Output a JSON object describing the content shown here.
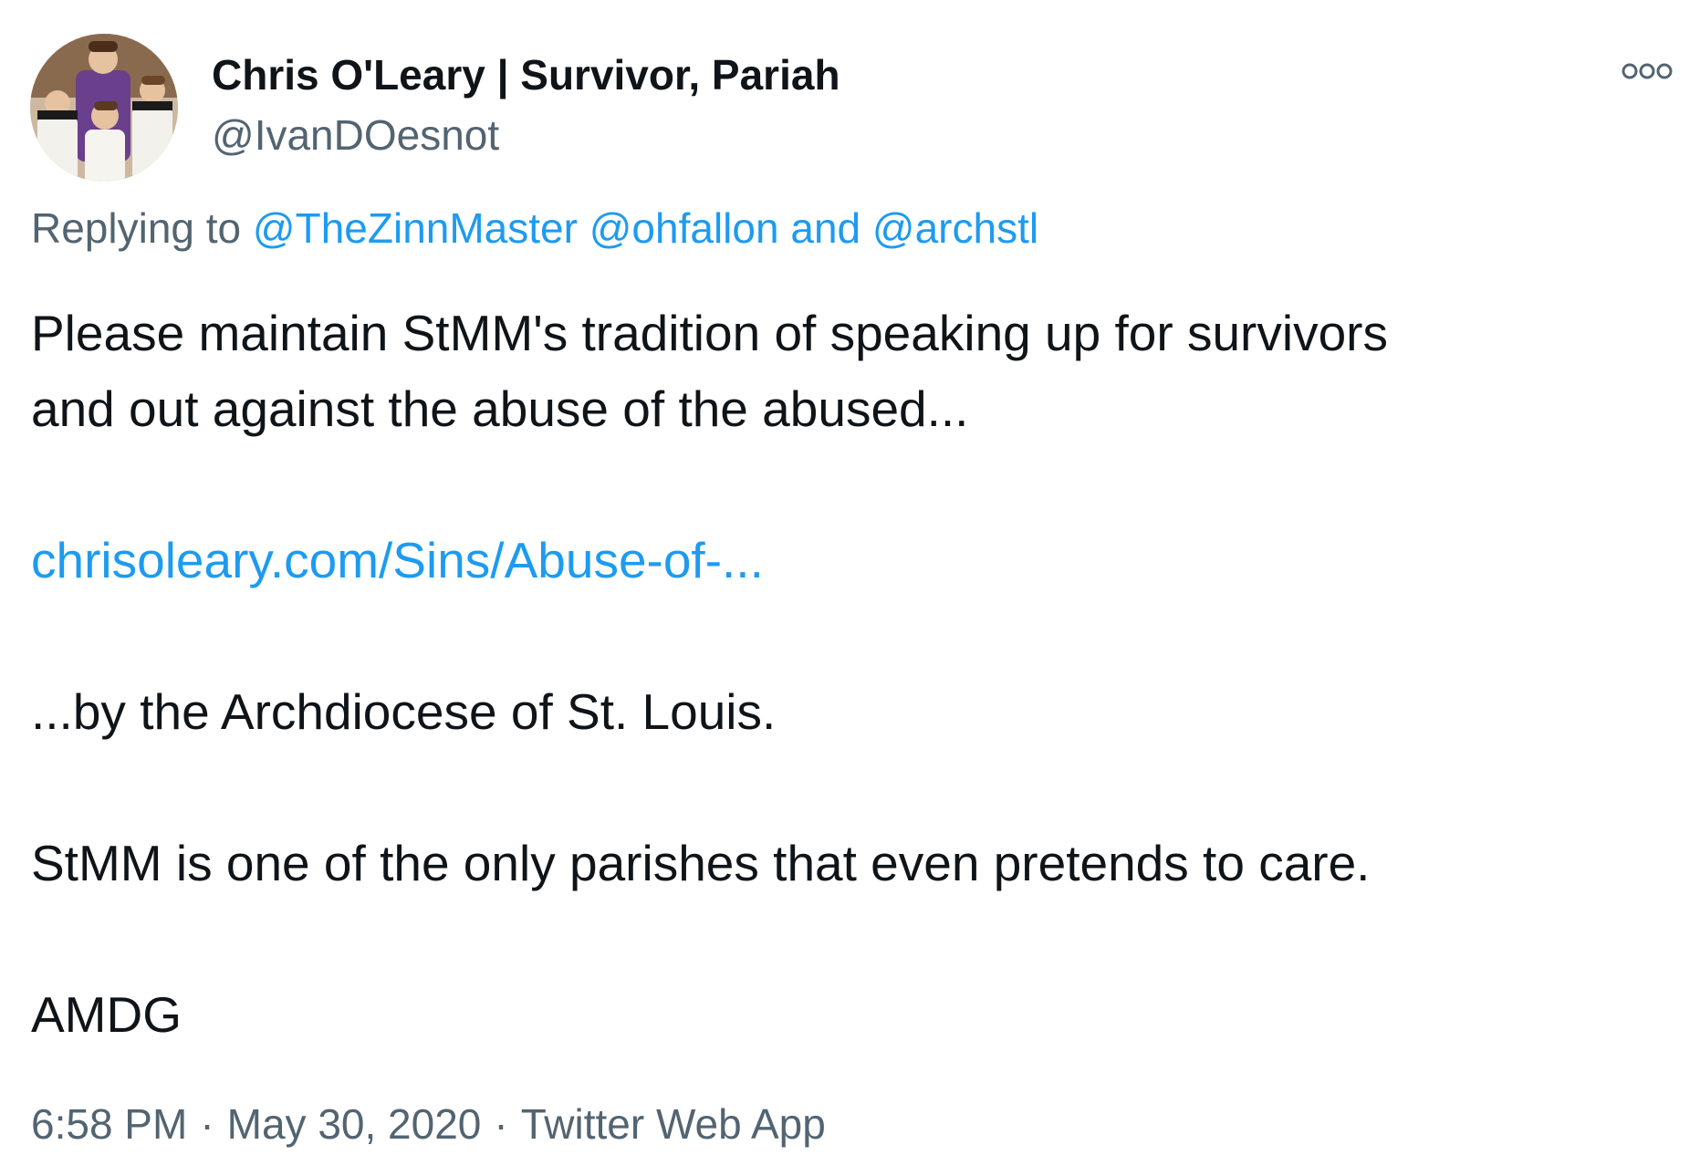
{
  "author": {
    "display_name": "Chris O'Leary | Survivor, Pariah",
    "handle": "@IvanDOesnot"
  },
  "reply": {
    "prefix": "Replying to",
    "mentions": [
      "@TheZinnMaster",
      "@ohfallon",
      "@archstl"
    ],
    "joiner": "and"
  },
  "tweet": {
    "line1": "Please maintain StMM's tradition of speaking up for survivors",
    "line2": "and out against the abuse of the abused...",
    "link": "chrisoleary.com/Sins/Abuse-of-...",
    "line3": "...by the Archdiocese of St. Louis.",
    "line4": "StMM is one of the only parishes that even pretends to care.",
    "line5": "AMDG"
  },
  "meta": {
    "time": "6:58 PM",
    "date": "May 30, 2020",
    "source": "Twitter Web App",
    "separator": "·"
  },
  "icons": {
    "more": "more-options-icon"
  },
  "colors": {
    "text": "#0f1419",
    "secondary": "#536471",
    "link": "#1d9bf0"
  }
}
